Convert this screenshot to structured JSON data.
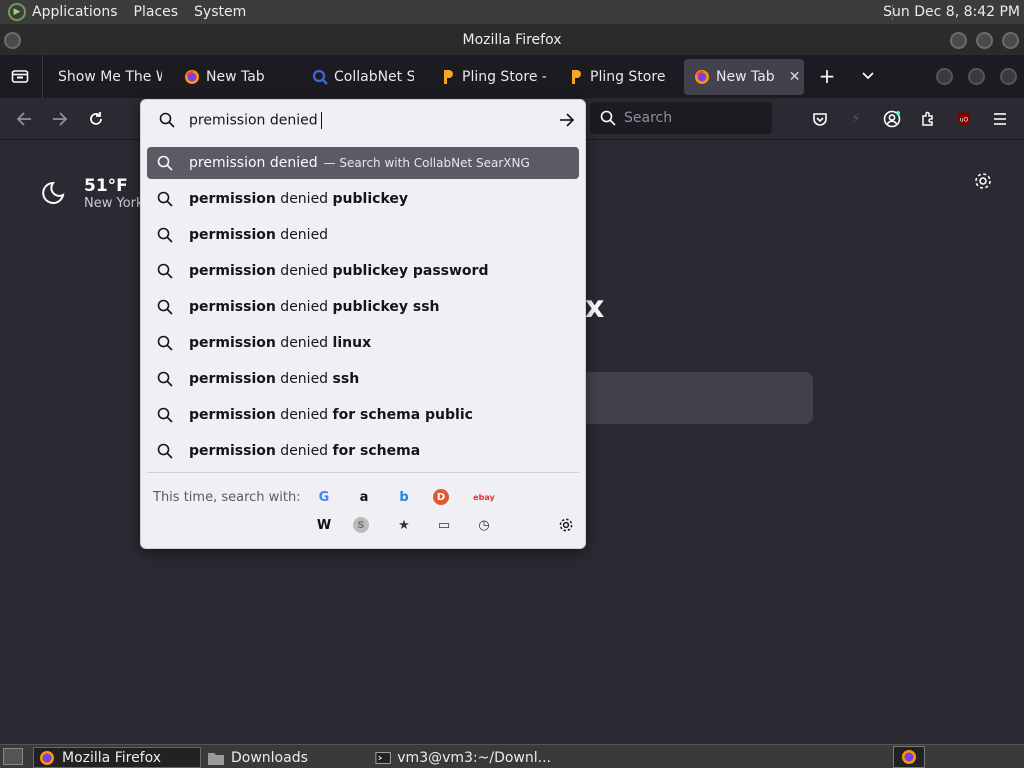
{
  "system_bar": {
    "menus": [
      "Applications",
      "Places",
      "System"
    ],
    "clock": "Sun Dec  8,  8:42 PM"
  },
  "window": {
    "title": "Mozilla Firefox"
  },
  "tabs": [
    {
      "label": "Show Me The W",
      "icon": "show-me-icon"
    },
    {
      "label": "New Tab",
      "icon": "firefox-icon"
    },
    {
      "label": "CollabNet Se",
      "icon": "search-icon"
    },
    {
      "label": "Pling Store - ",
      "icon": "pling-icon"
    },
    {
      "label": "Pling Store - ",
      "icon": "pling-icon"
    },
    {
      "label": "New Tab",
      "icon": "firefox-icon",
      "active": true
    }
  ],
  "urlbar": {
    "value": "premission denied"
  },
  "search_bar": {
    "placeholder": "Search"
  },
  "suggestions": {
    "selected": {
      "text": "premission denied",
      "hint": "— Search with CollabNet SearXNG"
    },
    "items": [
      {
        "bold1": "permission",
        "plain": " denied ",
        "bold2": "publickey"
      },
      {
        "bold1": "permission",
        "plain": " denied",
        "bold2": ""
      },
      {
        "bold1": "permission",
        "plain": " denied ",
        "bold2": "publickey password"
      },
      {
        "bold1": "permission",
        "plain": " denied ",
        "bold2": "publickey ssh"
      },
      {
        "bold1": "permission",
        "plain": " denied ",
        "bold2": "linux"
      },
      {
        "bold1": "permission",
        "plain": " denied ",
        "bold2": "ssh"
      },
      {
        "bold1": "permission",
        "plain": " denied ",
        "bold2": "for schema public"
      },
      {
        "bold1": "permission",
        "plain": " denied ",
        "bold2": "for schema"
      }
    ]
  },
  "one_off": {
    "label": "This time, search with:",
    "engines": [
      {
        "name": "google-icon",
        "glyph": "G",
        "color": "#4285f4"
      },
      {
        "name": "amazon-icon",
        "glyph": "a",
        "color": "#111111"
      },
      {
        "name": "bing-icon",
        "glyph": "b",
        "color": "#1e88e5"
      },
      {
        "name": "duckduckgo-icon",
        "glyph": "D",
        "color": "#de5833"
      },
      {
        "name": "ebay-icon",
        "glyph": "ebay",
        "color": "#e53238"
      },
      {
        "name": "wikipedia-icon",
        "glyph": "W",
        "color": "#111111"
      },
      {
        "name": "searxng-icon",
        "glyph": "S",
        "color": "#888888"
      },
      {
        "name": "bookmarks-icon",
        "glyph": "★",
        "color": "#333333"
      },
      {
        "name": "tabs-icon",
        "glyph": "▭",
        "color": "#333333"
      },
      {
        "name": "history-icon",
        "glyph": "◷",
        "color": "#333333"
      }
    ]
  },
  "newtab": {
    "weather_temp": "51°F",
    "weather_city": "New York",
    "brand_fragment": "x"
  },
  "taskbar": {
    "items": [
      {
        "label": "Mozilla Firefox",
        "active": true
      },
      {
        "label": "Downloads"
      },
      {
        "label": "vm3@vm3:~/Downl..."
      }
    ]
  }
}
